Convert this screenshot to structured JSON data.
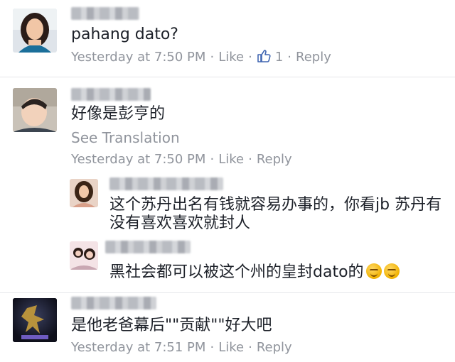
{
  "comments": [
    {
      "text": "pahang dato?",
      "timestamp": "Yesterday at 7:50 PM",
      "like_label": "Like",
      "like_count": "1",
      "reply_label": "Reply"
    },
    {
      "text": "好像是彭亨的",
      "see_translation": "See Translation",
      "timestamp": "Yesterday at 7:50 PM",
      "like_label": "Like",
      "reply_label": "Reply",
      "replies": [
        {
          "text_line1": "这个苏丹出名有钱就容易办事的，你看jb 苏丹有",
          "text_line2": "没有喜欢喜欢就封人"
        },
        {
          "text": "黑社会都可以被这个州的皇封dato的"
        }
      ]
    },
    {
      "text": "是他老爸幕后\"\"贡献\"\"好大吧",
      "timestamp": "Yesterday at 7:51 PM",
      "like_label": "Like",
      "reply_label": "Reply"
    }
  ],
  "separator": "·",
  "colors": {
    "meta": "#90949c",
    "text": "#1d2129",
    "divider": "#e6e7ea",
    "like_blue": "#4267b2"
  }
}
